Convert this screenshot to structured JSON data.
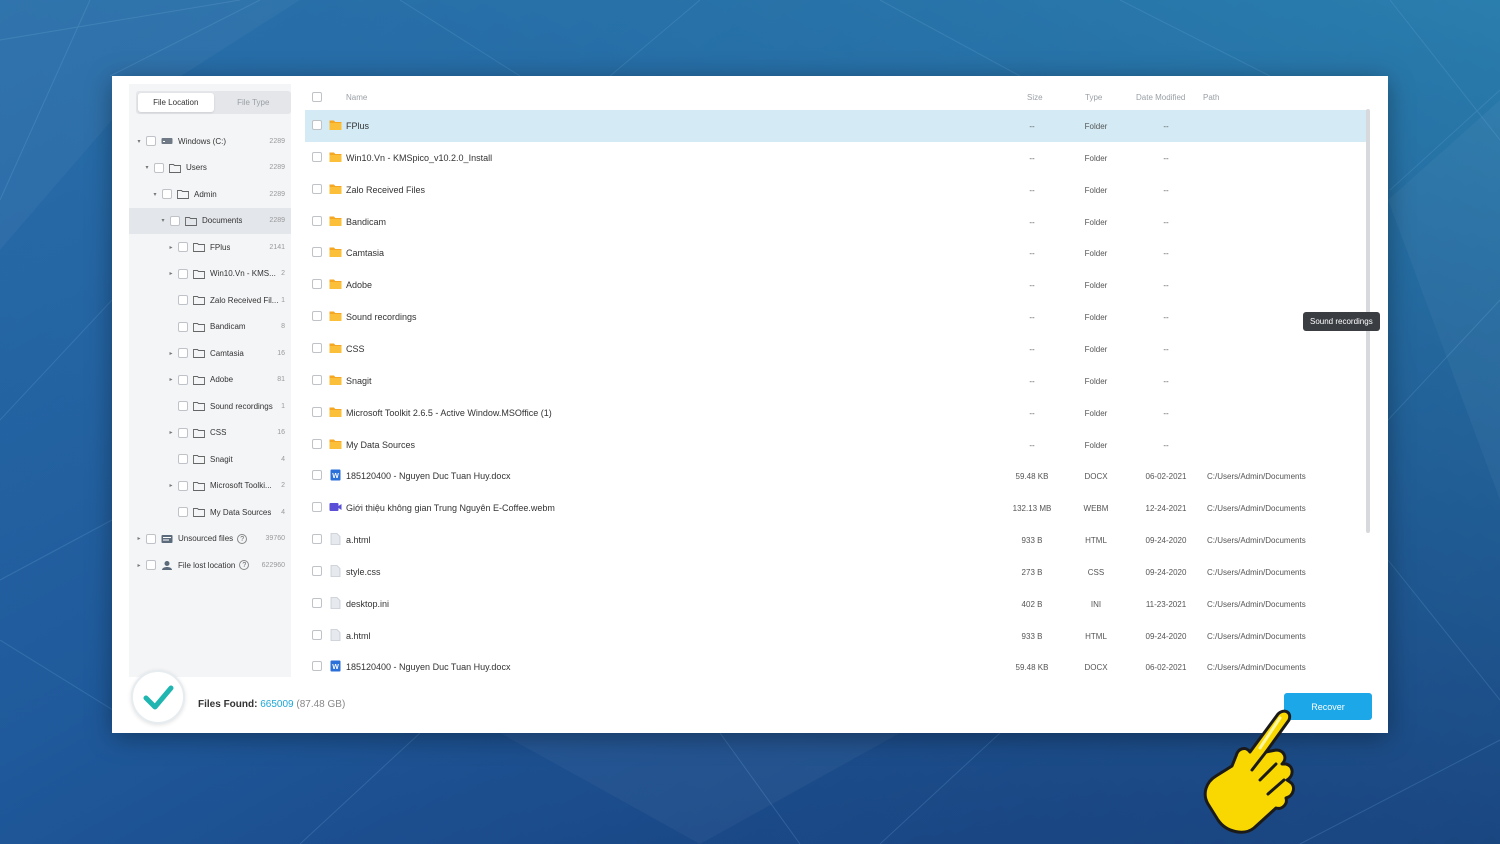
{
  "tabs": {
    "file_location": "File Location",
    "file_type": "File Type"
  },
  "tree": [
    {
      "label": "Windows (C:)",
      "count": "2289",
      "icon": "drive-icon"
    },
    {
      "label": "Users",
      "count": "2289",
      "icon": "folder-icon"
    },
    {
      "label": "Admin",
      "count": "2289",
      "icon": "folder-icon"
    },
    {
      "label": "Documents",
      "count": "2289",
      "icon": "folder-icon"
    },
    {
      "label": "FPlus",
      "count": "2141",
      "icon": "folder-icon"
    },
    {
      "label": "Win10.Vn - KMS...",
      "count": "2",
      "icon": "folder-icon"
    },
    {
      "label": "Zalo Received Fil...",
      "count": "1",
      "icon": "folder-icon"
    },
    {
      "label": "Bandicam",
      "count": "8",
      "icon": "folder-icon"
    },
    {
      "label": "Camtasia",
      "count": "16",
      "icon": "folder-icon"
    },
    {
      "label": "Adobe",
      "count": "81",
      "icon": "folder-icon"
    },
    {
      "label": "Sound recordings",
      "count": "1",
      "icon": "folder-icon"
    },
    {
      "label": "CSS",
      "count": "16",
      "icon": "folder-icon"
    },
    {
      "label": "Snagit",
      "count": "4",
      "icon": "folder-icon"
    },
    {
      "label": "Microsoft Toolki...",
      "count": "2",
      "icon": "folder-icon"
    },
    {
      "label": "My Data Sources",
      "count": "4",
      "icon": "folder-icon"
    },
    {
      "label": "Unsourced files",
      "count": "39760",
      "icon": "unsourced-icon"
    },
    {
      "label": "File lost location",
      "count": "622960",
      "icon": "lost-location-icon"
    }
  ],
  "columns": {
    "name": "Name",
    "size": "Size",
    "type": "Type",
    "date": "Date Modified",
    "path": "Path"
  },
  "rows": [
    {
      "name": "FPlus",
      "size": "--",
      "type": "Folder",
      "date": "--",
      "path": "",
      "icon": "folder-icon"
    },
    {
      "name": "Win10.Vn - KMSpico_v10.2.0_Install",
      "size": "--",
      "type": "Folder",
      "date": "--",
      "path": "",
      "icon": "folder-icon"
    },
    {
      "name": "Zalo Received Files",
      "size": "--",
      "type": "Folder",
      "date": "--",
      "path": "",
      "icon": "folder-icon"
    },
    {
      "name": "Bandicam",
      "size": "--",
      "type": "Folder",
      "date": "--",
      "path": "",
      "icon": "folder-icon"
    },
    {
      "name": "Camtasia",
      "size": "--",
      "type": "Folder",
      "date": "--",
      "path": "",
      "icon": "folder-icon"
    },
    {
      "name": "Adobe",
      "size": "--",
      "type": "Folder",
      "date": "--",
      "path": "",
      "icon": "folder-icon"
    },
    {
      "name": "Sound recordings",
      "size": "--",
      "type": "Folder",
      "date": "--",
      "path": "",
      "icon": "folder-icon"
    },
    {
      "name": "CSS",
      "size": "--",
      "type": "Folder",
      "date": "--",
      "path": "",
      "icon": "folder-icon"
    },
    {
      "name": "Snagit",
      "size": "--",
      "type": "Folder",
      "date": "--",
      "path": "",
      "icon": "folder-icon"
    },
    {
      "name": "Microsoft Toolkit 2.6.5 - Active Window.MSOffice (1)",
      "size": "--",
      "type": "Folder",
      "date": "--",
      "path": "",
      "icon": "folder-icon"
    },
    {
      "name": "My Data Sources",
      "size": "--",
      "type": "Folder",
      "date": "--",
      "path": "",
      "icon": "folder-icon"
    },
    {
      "name": "185120400 - Nguyen Duc Tuan Huy.docx",
      "size": "59.48 KB",
      "type": "DOCX",
      "date": "06-02-2021",
      "path": "C:/Users/Admin/Documents",
      "icon": "word-doc-icon"
    },
    {
      "name": "Giới thiệu không gian Trung Nguyên E-Coffee.webm",
      "size": "132.13 MB",
      "type": "WEBM",
      "date": "12-24-2021",
      "path": "C:/Users/Admin/Documents",
      "icon": "video-file-icon"
    },
    {
      "name": "a.html",
      "size": "933 B",
      "type": "HTML",
      "date": "09-24-2020",
      "path": "C:/Users/Admin/Documents",
      "icon": "file-icon"
    },
    {
      "name": "style.css",
      "size": "273 B",
      "type": "CSS",
      "date": "09-24-2020",
      "path": "C:/Users/Admin/Documents",
      "icon": "file-icon"
    },
    {
      "name": "desktop.ini",
      "size": "402 B",
      "type": "INI",
      "date": "11-23-2021",
      "path": "C:/Users/Admin/Documents",
      "icon": "file-icon"
    },
    {
      "name": "a.html",
      "size": "933 B",
      "type": "HTML",
      "date": "09-24-2020",
      "path": "C:/Users/Admin/Documents",
      "icon": "file-icon"
    },
    {
      "name": "185120400 - Nguyen Duc Tuan Huy.docx",
      "size": "59.48 KB",
      "type": "DOCX",
      "date": "06-02-2021",
      "path": "C:/Users/Admin/Documents",
      "icon": "word-doc-icon"
    }
  ],
  "tooltip": "Sound recordings",
  "footer": {
    "label": "Files Found:",
    "count": "665009",
    "size": "(87.48 GB)",
    "recover": "Recover"
  },
  "colors": {
    "accent": "#1ba7e8",
    "selected_row": "#d4ebf5",
    "folder": "#f5a623",
    "check": "#1fb5b0"
  }
}
